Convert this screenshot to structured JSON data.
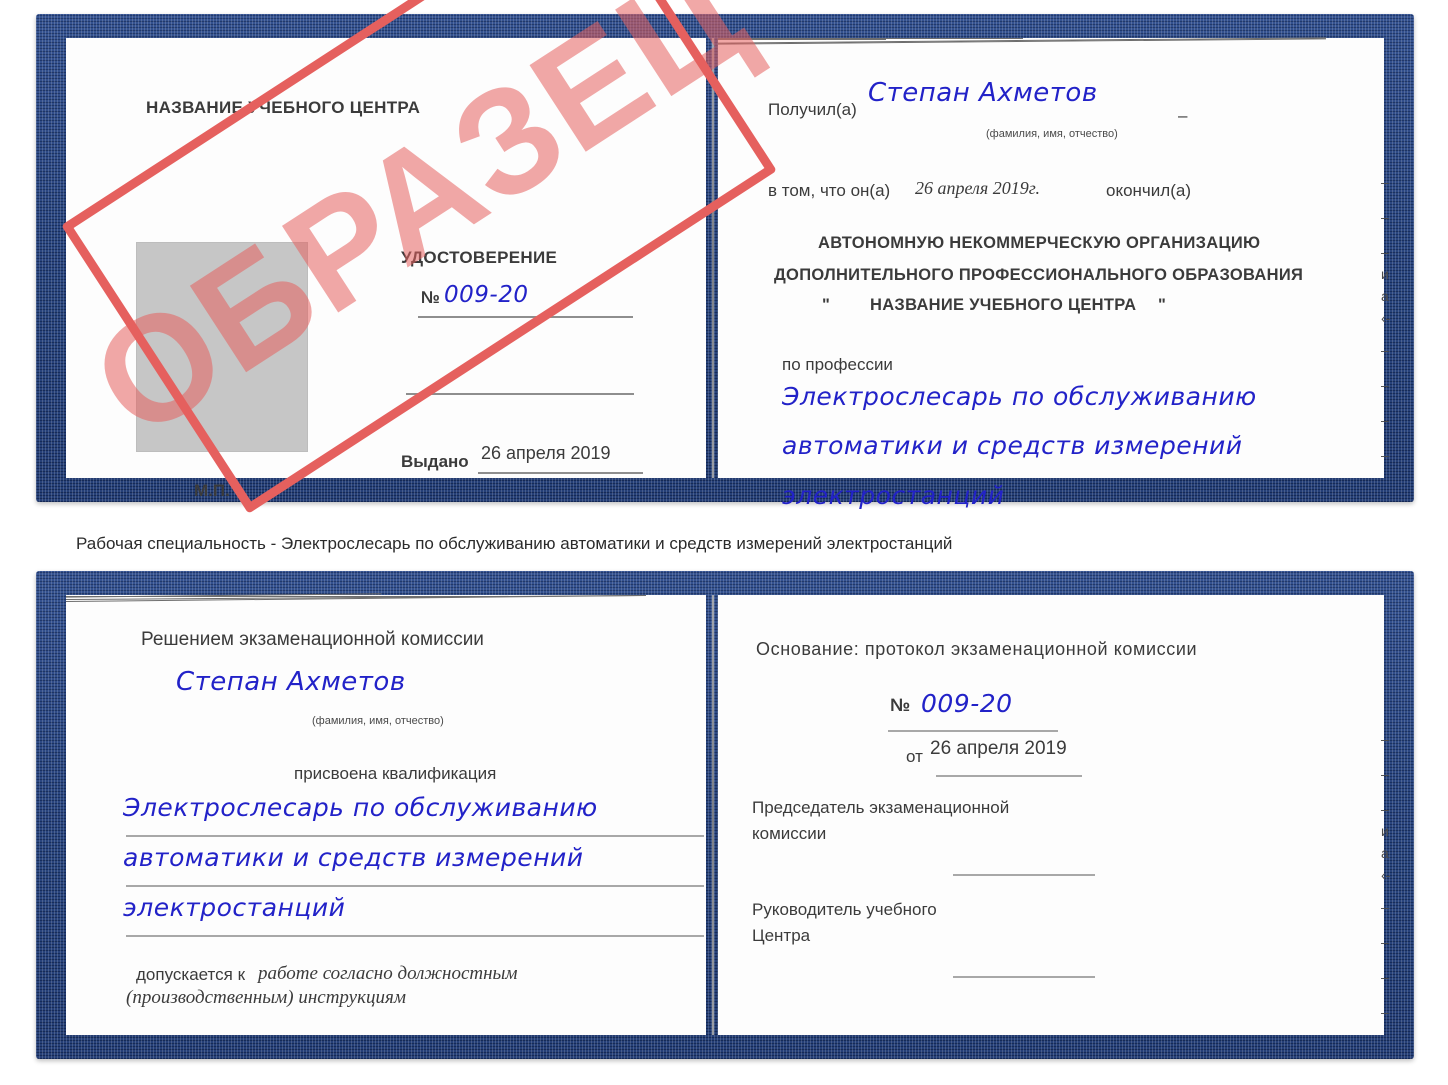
{
  "colors": {
    "cover_blue": "#1f3d7a",
    "handwriting_blue": "#2222c8",
    "stamp_red": "#e5605e",
    "page_white": "#fdfdfd",
    "photo_grey": "#c6c6c6",
    "rule_grey": "#8e8e8e"
  },
  "stamp": {
    "label": "ОБРАЗЕЦ"
  },
  "caption": {
    "text": "Рабочая специальность - Электрослесарь по обслуживанию автоматики и средств измерений электростанций"
  },
  "certificate_top": {
    "left_page": {
      "center_title": "НАЗВАНИЕ УЧЕБНОГО ЦЕНТРА",
      "doc_type": "УДОСТОВЕРЕНИЕ",
      "number_label": "№",
      "number_value": "009-20",
      "issued_label": "Выдано",
      "issued_value": "26 апреля 2019",
      "seal_label": "М.П.",
      "photo_placeholder": "photo"
    },
    "right_page": {
      "received_label": "Получил(а)",
      "received_value": "Степан Ахметов",
      "name_hint": "(фамилия, имя, отчество)",
      "in_that_label": "в том, что он(а)",
      "completion_date": "26 апреля 2019г.",
      "finished_label": "окончил(а)",
      "org_line_1": "АВТОНОМНУЮ НЕКОММЕРЧЕСКУЮ ОРГАНИЗАЦИЮ",
      "org_line_2": "ДОПОЛНИТЕЛЬНОГО ПРОФЕССИОНАЛЬНОГО ОБРАЗОВАНИЯ",
      "org_line_3_quote_open": "\"",
      "org_line_3": "НАЗВАНИЕ УЧЕБНОГО ЦЕНТРА",
      "org_line_3_quote_close": "\"",
      "profession_label": "по профессии",
      "profession_line_1": "Электрослесарь по обслуживанию",
      "profession_line_2": "автоматики и средств измерений",
      "profession_line_3": "электростанций",
      "edge_marks": [
        "–",
        "–",
        "–",
        "и",
        "а",
        "‹-",
        "–",
        "–",
        "–",
        "–"
      ]
    }
  },
  "certificate_bottom": {
    "left_page": {
      "heading": "Решением экзаменационной комиссии",
      "name_value": "Степан Ахметов",
      "name_hint": "(фамилия, имя, отчество)",
      "qualification_label": "присвоена квалификация",
      "qualification_line_1": "Электрослесарь по обслуживанию",
      "qualification_line_2": "автоматики и средств измерений",
      "qualification_line_3": "электростанций",
      "allowed_label": "допускается к",
      "allowed_value_line_1": "работе согласно должностным",
      "allowed_value_line_2": "(производственным) инструкциям"
    },
    "right_page": {
      "basis_label": "Основание: протокол экзаменационной комиссии",
      "number_label": "№",
      "number_value": "009-20",
      "from_label": "от",
      "from_value": "26 апреля 2019",
      "chairman_line_1": "Председатель экзаменационной",
      "chairman_line_2": "комиссии",
      "head_line_1": "Руководитель учебного",
      "head_line_2": "Центра",
      "edge_marks": [
        "–",
        "–",
        "–",
        "и",
        "а",
        "‹-",
        "–",
        "–",
        "–",
        "–"
      ]
    }
  }
}
